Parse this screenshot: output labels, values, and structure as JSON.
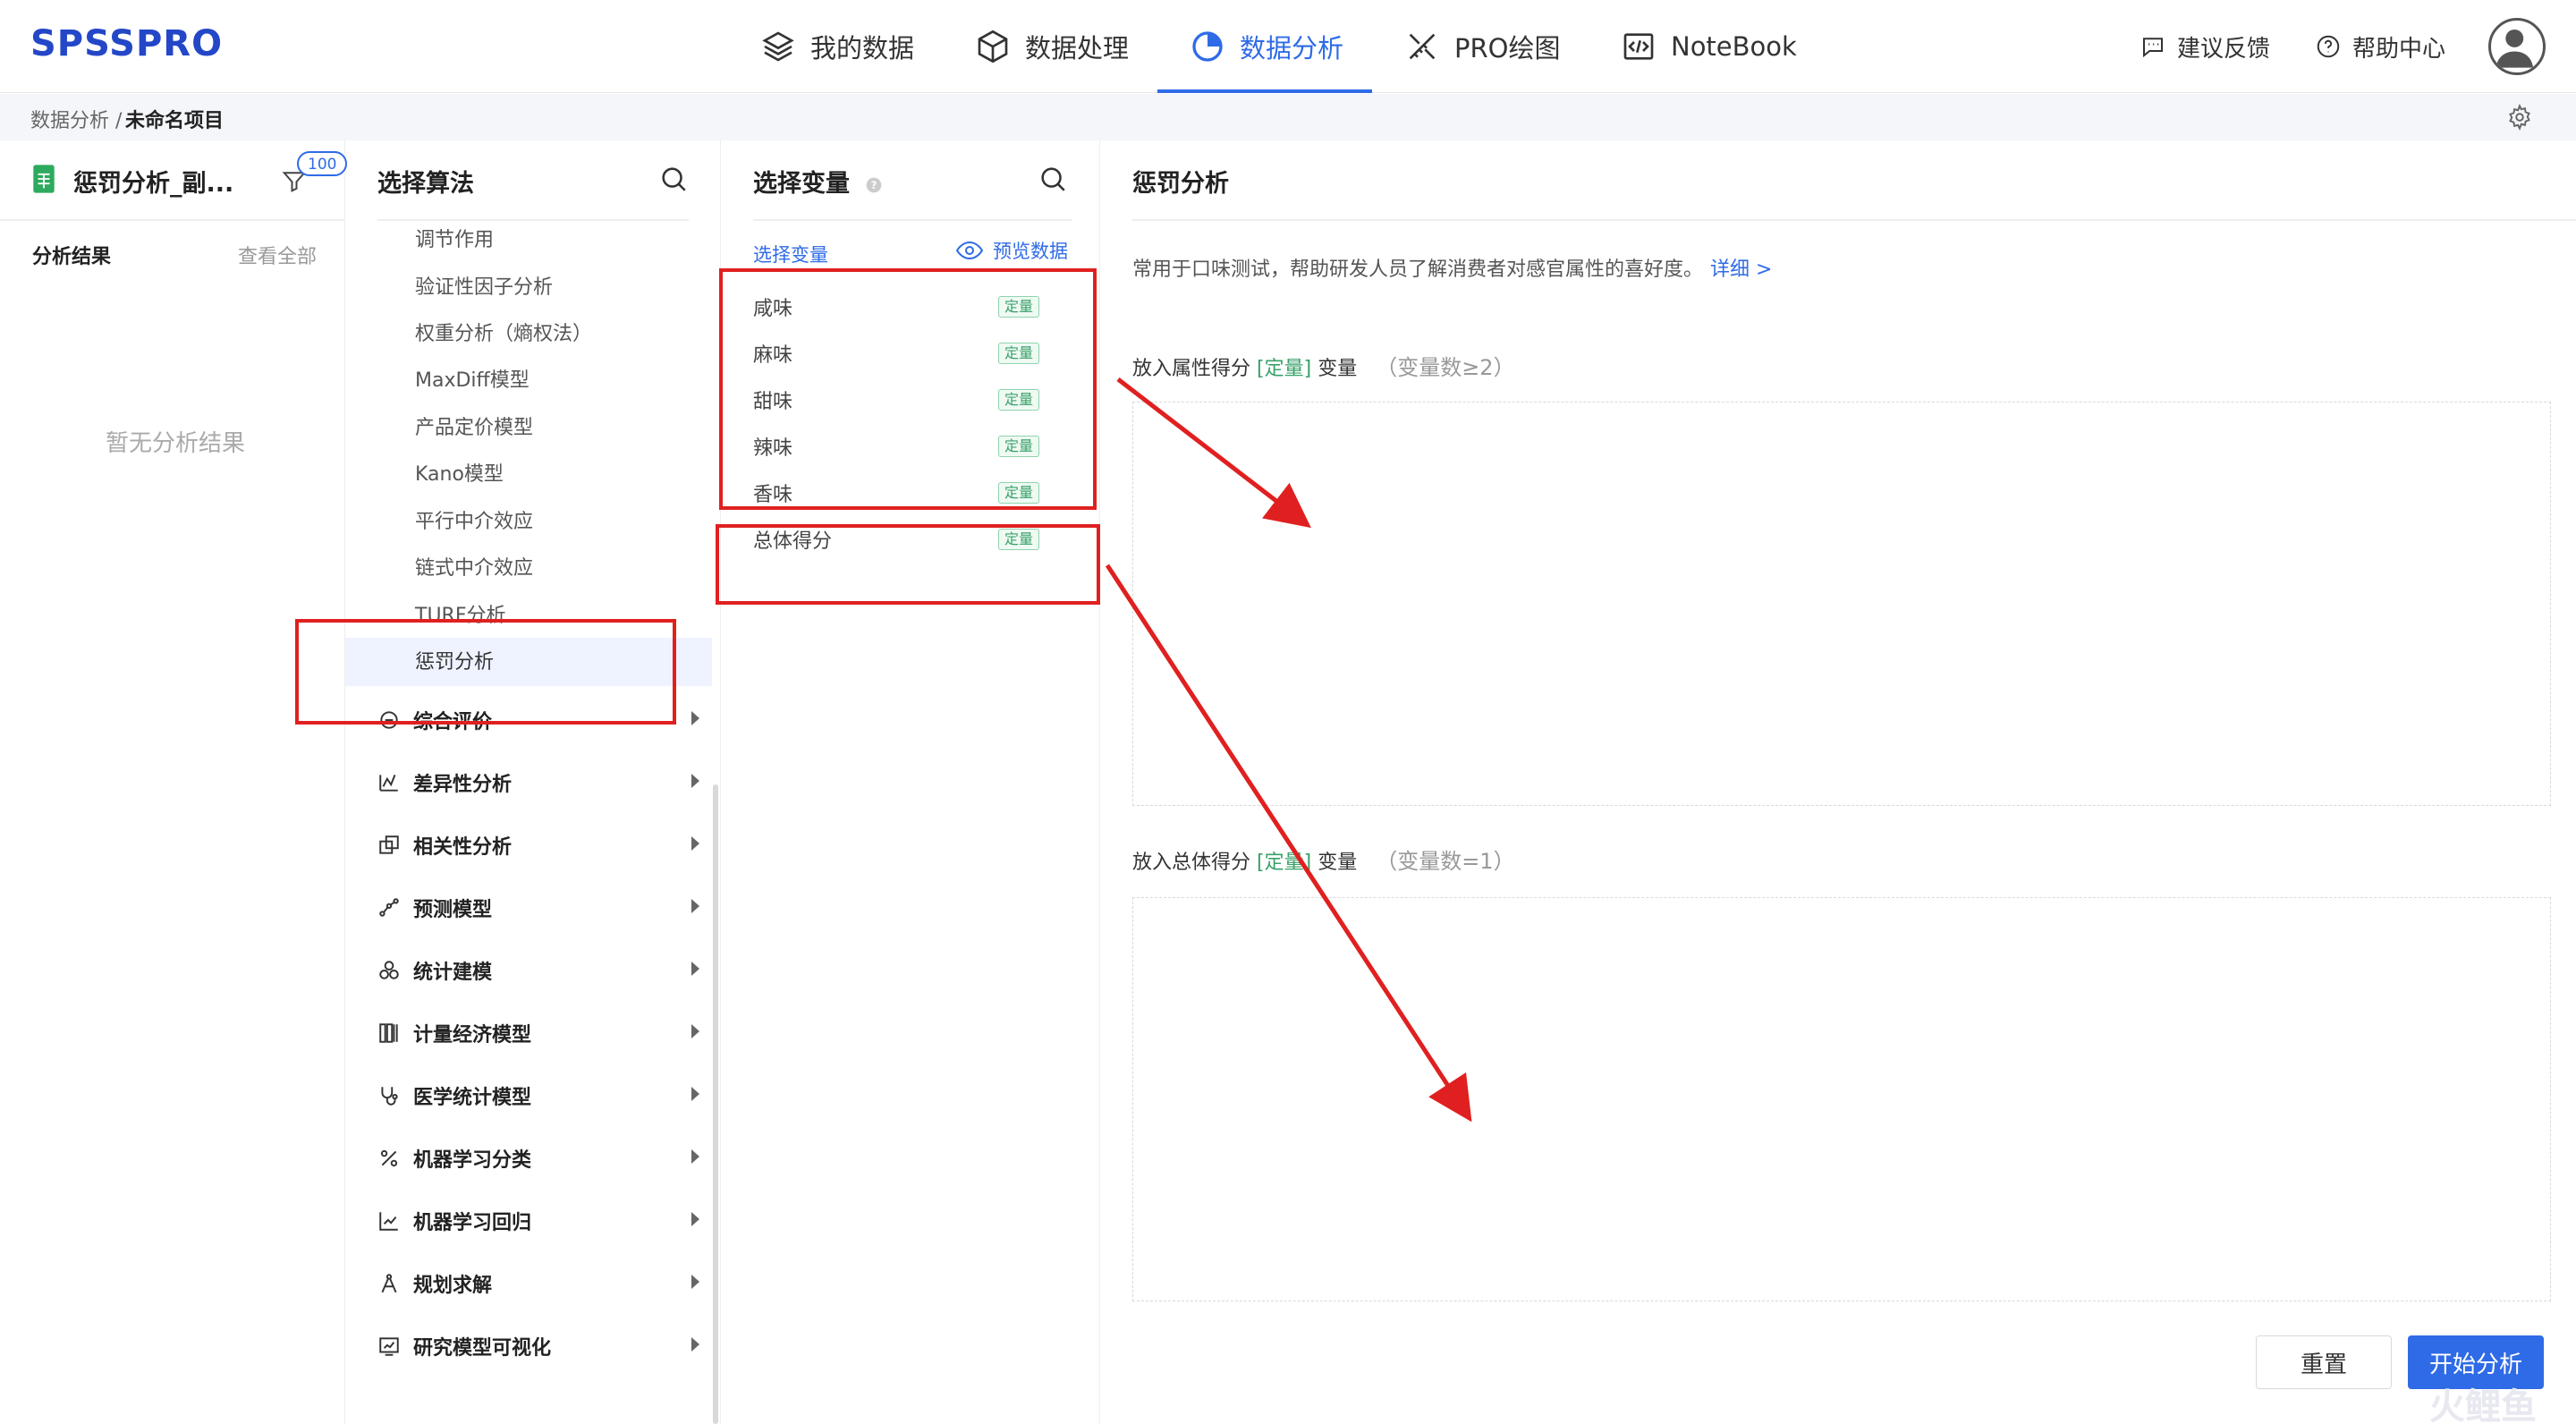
{
  "brand": {
    "logo": "SPSSPRO",
    "accent": "#2f6be6"
  },
  "nav": {
    "items": [
      {
        "label": "我的数据",
        "icon": "layers-icon"
      },
      {
        "label": "数据处理",
        "icon": "cube-icon"
      },
      {
        "label": "数据分析",
        "icon": "pie-chart-icon",
        "active": true
      },
      {
        "label": "PRO绘图",
        "icon": "pen-ruler-icon"
      },
      {
        "label": "NoteBook",
        "icon": "code-icon"
      }
    ],
    "feedback": "建议反馈",
    "help": "帮助中心"
  },
  "breadcrumb": {
    "parent": "数据分析 /",
    "current": "未命名项目"
  },
  "project": {
    "title": "惩罚分析_副...",
    "filter_badge": "100"
  },
  "results": {
    "label": "分析结果",
    "view_all": "查看全部",
    "empty": "暂无分析结果"
  },
  "algorithms": {
    "title": "选择算法",
    "sub_items": [
      "调节作用",
      "验证性因子分析",
      "权重分析（熵权法）",
      "MaxDiff模型",
      "产品定价模型",
      "Kano模型",
      "平行中介效应",
      "链式中介效应",
      "TURF分析",
      "惩罚分析"
    ],
    "selected": "惩罚分析",
    "categories": [
      "综合评价",
      "差异性分析",
      "相关性分析",
      "预测模型",
      "统计建模",
      "计量经济模型",
      "医学统计模型",
      "机器学习分类",
      "机器学习回归",
      "规划求解",
      "研究模型可视化"
    ]
  },
  "variables": {
    "title": "选择变量",
    "select_link": "选择变量",
    "preview": "预览数据",
    "items": [
      {
        "name": "咸味",
        "type": "定量"
      },
      {
        "name": "麻味",
        "type": "定量"
      },
      {
        "name": "甜味",
        "type": "定量"
      },
      {
        "name": "辣味",
        "type": "定量"
      },
      {
        "name": "香味",
        "type": "定量"
      },
      {
        "name": "总体得分",
        "type": "定量"
      }
    ]
  },
  "main": {
    "title": "惩罚分析",
    "description": "常用于口味测试，帮助研发人员了解消费者对感官属性的喜好度。",
    "detail_link": "详细 >",
    "drop1": {
      "prefix": "放入属性得分",
      "tag": "[定量]",
      "suffix": "变量",
      "hint": "（变量数≥2）"
    },
    "drop2": {
      "prefix": "放入总体得分",
      "tag": "[定量]",
      "suffix": "变量",
      "hint": "（变量数=1）"
    },
    "reset": "重置",
    "start": "开始分析"
  },
  "watermark": "火鲤鱼"
}
